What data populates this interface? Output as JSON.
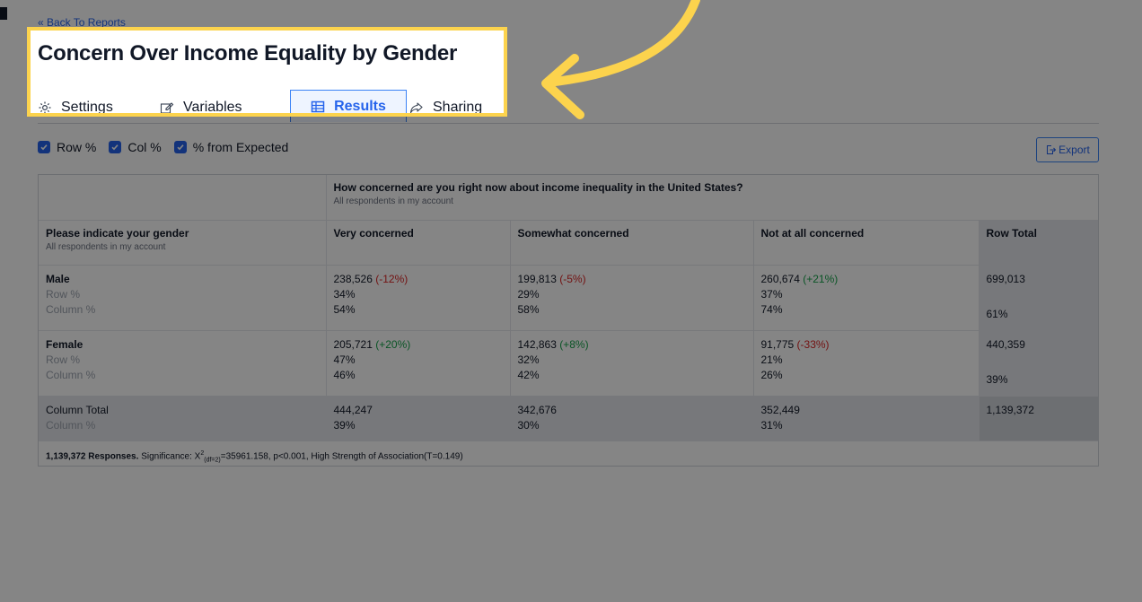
{
  "nav": {
    "back_label": "« Back To Reports"
  },
  "page": {
    "title": "Concern Over Income Equality by Gender"
  },
  "tabs": [
    {
      "label": "Settings",
      "icon": "gear-icon"
    },
    {
      "label": "Variables",
      "icon": "edit-icon"
    },
    {
      "label": "Results",
      "icon": "table-icon",
      "active": true
    },
    {
      "label": "Sharing",
      "icon": "share-icon"
    }
  ],
  "options": [
    {
      "label": "Row %",
      "checked": true
    },
    {
      "label": "Col %",
      "checked": true
    },
    {
      "label": "% from Expected",
      "checked": true
    }
  ],
  "export": {
    "label": "Export",
    "icon": "export-icon"
  },
  "table": {
    "col_question": "How concerned are you right now about income inequality in the United States?",
    "col_question_sub": "All respondents in my account",
    "row_question": "Please indicate your gender",
    "row_question_sub": "All respondents in my account",
    "headers": [
      "Very concerned",
      "Somewhat concerned",
      "Not at all concerned",
      "Row Total"
    ],
    "row_pct_label": "Row %",
    "col_pct_label": "Column %",
    "rows": [
      {
        "label": "Male",
        "cells": [
          {
            "count": "238,526",
            "diff": "(-12%)",
            "row_pct": "34%",
            "col_pct": "54%"
          },
          {
            "count": "199,813",
            "diff": "(-5%)",
            "row_pct": "29%",
            "col_pct": "58%"
          },
          {
            "count": "260,674",
            "diff": "(+21%)",
            "row_pct": "37%",
            "col_pct": "74%"
          }
        ],
        "total": "699,013",
        "total_pct": "61%"
      },
      {
        "label": "Female",
        "cells": [
          {
            "count": "205,721",
            "diff": "(+20%)",
            "row_pct": "47%",
            "col_pct": "46%"
          },
          {
            "count": "142,863",
            "diff": "(+8%)",
            "row_pct": "32%",
            "col_pct": "42%"
          },
          {
            "count": "91,775",
            "diff": "(-33%)",
            "row_pct": "21%",
            "col_pct": "26%"
          }
        ],
        "total": "440,359",
        "total_pct": "39%"
      }
    ],
    "column_total_label": "Column Total",
    "column_totals": [
      {
        "count": "444,247",
        "col_pct": "39%"
      },
      {
        "count": "342,676",
        "col_pct": "30%"
      },
      {
        "count": "352,449",
        "col_pct": "31%"
      }
    ],
    "grand_total": "1,139,372"
  },
  "footer": {
    "responses": "1,139,372 Responses.",
    "sig_label": "Significance: X",
    "sig_sup": "2",
    "sig_sub": "(df=2)",
    "sig_rest": "=35961.158, p<0.001, High Strength of Association(T=0.149)"
  },
  "colors": {
    "accent": "#2563eb",
    "highlight": "#fcd34d",
    "negative": "#dc2626",
    "positive": "#16a34a"
  }
}
